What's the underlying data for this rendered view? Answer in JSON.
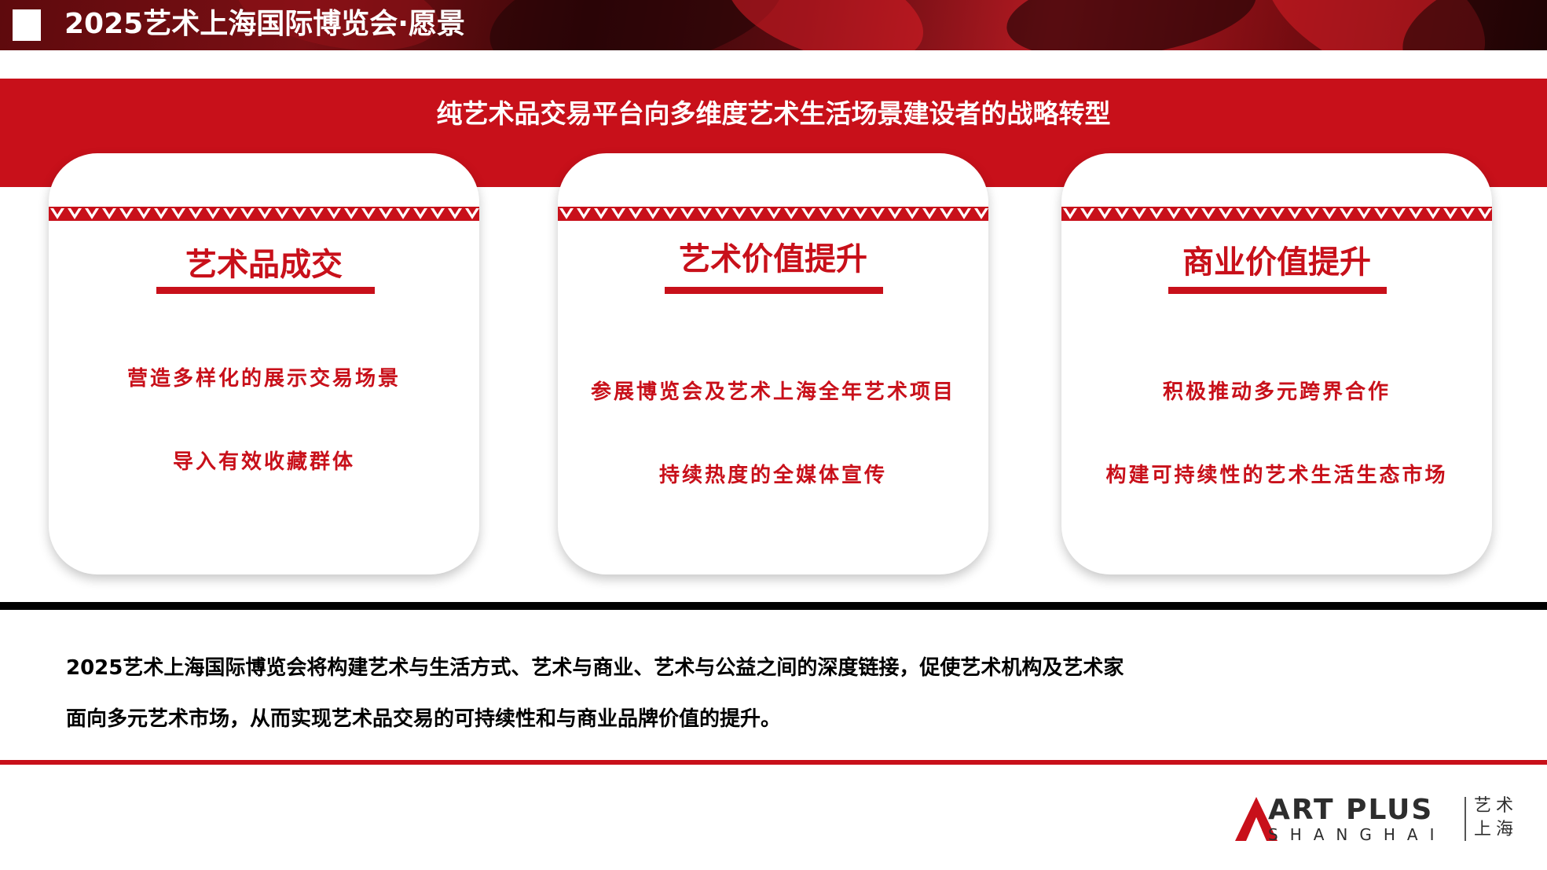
{
  "header": {
    "title": "2025艺术上海国际博览会·愿景"
  },
  "strategy": {
    "title": "纯艺术品交易平台向多维度艺术生活场景建设者的战略转型"
  },
  "cards": [
    {
      "title": "艺术品成交",
      "items": [
        "营造多样化的展示交易场景",
        "导入有效收藏群体"
      ]
    },
    {
      "title": "艺术价值提升",
      "items": [
        "参展博览会及艺术上海全年艺术项目",
        "持续热度的全媒体宣传"
      ]
    },
    {
      "title": "商业价值提升",
      "items": [
        "积极推动多元跨界合作",
        "构建可持续性的艺术生活生态市场"
      ]
    }
  ],
  "description": {
    "line1": "2025艺术上海国际博览会将构建艺术与生活方式、艺术与商业、艺术与公益之间的深度链接，促使艺术机构及艺术家",
    "line2": "面向多元艺术市场，从而实现艺术品交易的可持续性和与商业品牌价值的提升。"
  },
  "logo": {
    "name": "ART PLUS",
    "city": "SHANGHAI",
    "cn_line1": "艺术",
    "cn_line2": "上海"
  },
  "colors": {
    "accent_red": "#c8101a",
    "black": "#000000",
    "white": "#ffffff"
  }
}
